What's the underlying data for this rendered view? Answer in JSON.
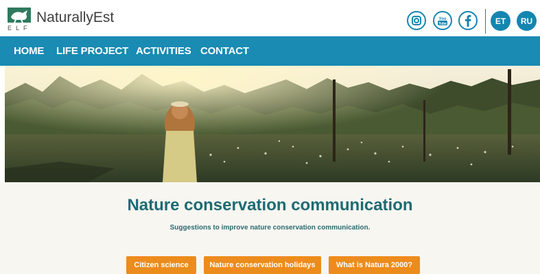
{
  "brand": {
    "name": "NaturallyEst",
    "logo_letters": "ELF",
    "logo_icon": "bird-logo-icon"
  },
  "social": [
    {
      "name": "instagram-icon"
    },
    {
      "name": "youtube-icon",
      "label_top": "You",
      "label_bottom": "Tube"
    },
    {
      "name": "facebook-icon"
    }
  ],
  "languages": [
    "ET",
    "RU"
  ],
  "nav": {
    "items": [
      "HOME",
      "LIFE PROJECT",
      "ACTIVITIES",
      "CONTACT"
    ]
  },
  "hero": {
    "image": "bog-landscape-with-girl"
  },
  "main": {
    "title": "Nature conservation communication",
    "subtitle": "Suggestions to improve nature conservation communication.",
    "buttons": [
      "Citizen science",
      "Nature conservation holidays",
      "What is Natura 2000?"
    ]
  },
  "colors": {
    "primary": "#1a8bb3",
    "heading": "#1d6a72",
    "accent": "#ec8c1c",
    "logo": "#2e7a5f"
  }
}
